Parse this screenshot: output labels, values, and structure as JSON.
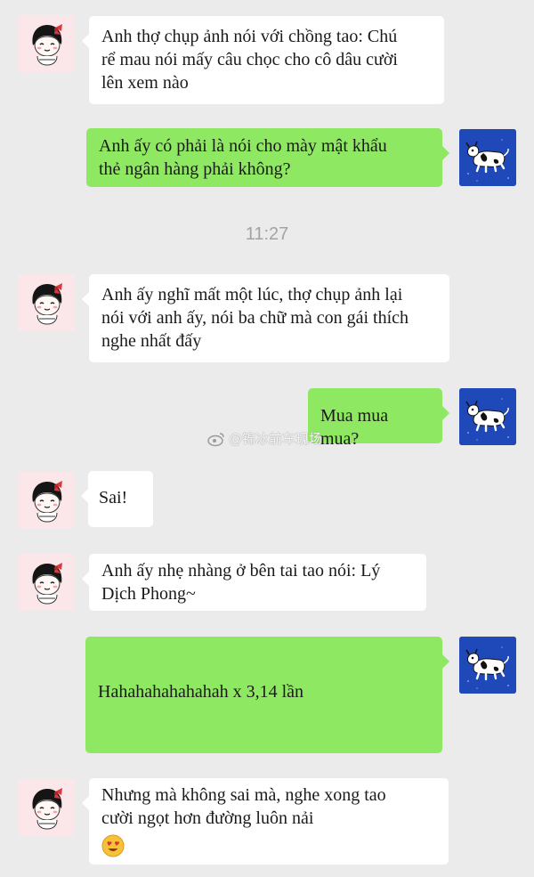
{
  "conversation": {
    "timestamp": "11:27",
    "watermark": "@锦冰前车现场",
    "messages": [
      {
        "sender": "other",
        "lines": [
          "Anh thợ chụp ảnh nói với chồng tao: Chú",
          "rể mau nói mấy câu chọc cho cô dâu cười",
          "lên xem nào"
        ]
      },
      {
        "sender": "me",
        "lines": [
          "Anh ấy có phải là nói cho mày mật khẩu",
          "thẻ ngân hàng phải không?"
        ]
      },
      {
        "sender": "other",
        "lines": [
          "Anh ấy nghĩ mất một lúc, thợ chụp ảnh lại",
          "nói với anh ấy, nói ba chữ mà con gái thích",
          "nghe nhất đấy"
        ]
      },
      {
        "sender": "me",
        "lines": [
          "Mua mua mua?"
        ]
      },
      {
        "sender": "other",
        "lines": [
          "Sai!"
        ]
      },
      {
        "sender": "other",
        "lines": [
          "Anh ấy nhẹ nhàng ở bên tai tao nói: Lý",
          "Dịch Phong~"
        ]
      },
      {
        "sender": "me",
        "lines": [
          "Hahahahahahahah x 3,14 lần"
        ]
      },
      {
        "sender": "other",
        "lines": [
          "Nhưng mà không sai mà, nghe xong tao",
          "cười ngọt hơn đường luôn nải"
        ],
        "emoji": "heart-eyes-emoji"
      }
    ]
  },
  "avatars": {
    "other": "girl-avatar",
    "me": "cow-avatar"
  },
  "colors": {
    "outgoing_bubble": "#8fe862",
    "incoming_bubble": "#ffffff",
    "background": "#ebebeb",
    "cow_avatar_bg": "#1f49b8"
  }
}
